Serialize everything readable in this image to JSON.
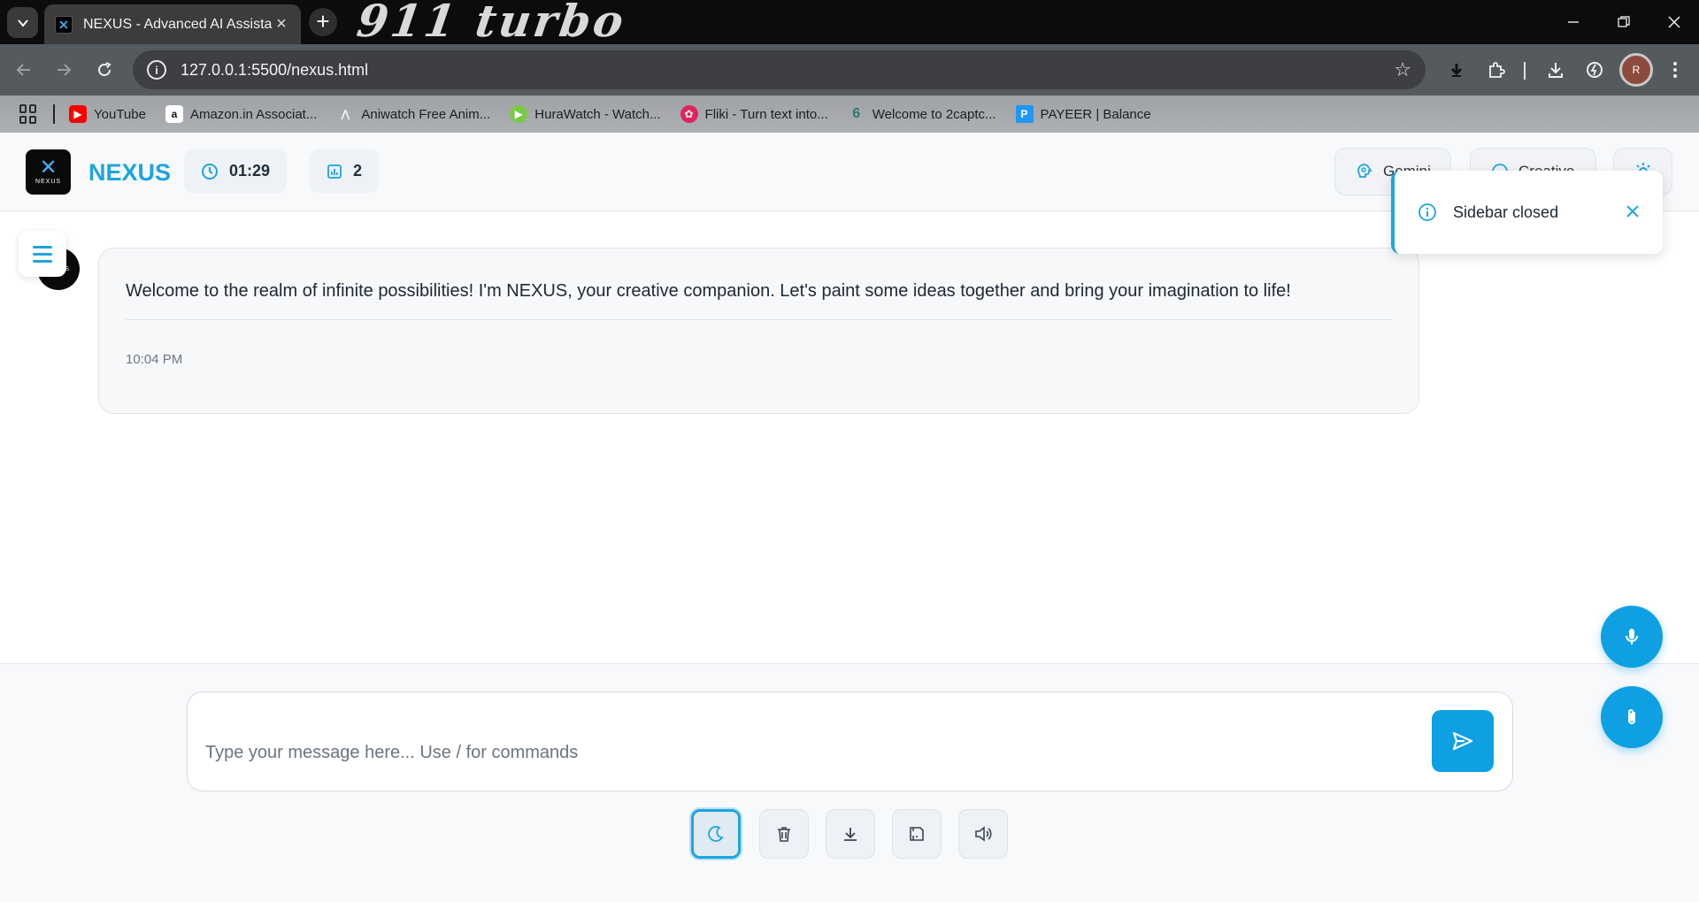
{
  "browser": {
    "tab_title": "NEXUS - Advanced AI Assistant",
    "theme_logo_text": "911 turbo",
    "url": "127.0.0.1:5500/nexus.html",
    "profile_initial": "R",
    "bookmarks": [
      {
        "label": "YouTube",
        "icon": "youtube-icon",
        "color": "#ff0000"
      },
      {
        "label": "Amazon.in Associat...",
        "icon": "amazon-icon",
        "color": "#ffffff"
      },
      {
        "label": "Aniwatch Free Anim...",
        "icon": "aniwatch-icon",
        "color": "#e8e8e8"
      },
      {
        "label": "HuraWatch - Watch...",
        "icon": "hurawatch-icon",
        "color": "#7ac943"
      },
      {
        "label": "Fliki - Turn text into...",
        "icon": "fliki-icon",
        "color": "#e0245e"
      },
      {
        "label": "Welcome to 2captc...",
        "icon": "2captcha-icon",
        "color": "#2b7a6f"
      },
      {
        "label": "PAYEER | Balance",
        "icon": "payeer-icon",
        "color": "#2196f3"
      }
    ]
  },
  "app": {
    "brand": "NEXUS",
    "logo_text": "NEXUS",
    "timer": "01:29",
    "message_count": "2",
    "model_button": "Gemini",
    "mode_button": "Creative",
    "accent_color": "#1ea5df"
  },
  "chat": {
    "avatar_text": "NEXUS",
    "messages": [
      {
        "text": "Welcome to the realm of infinite possibilities! I'm NEXUS, your creative companion. Let's paint some ideas together and bring your imagination to life!",
        "time": "10:04 PM"
      }
    ]
  },
  "toast": {
    "text": "Sidebar closed"
  },
  "input": {
    "placeholder": "Type your message here... Use / for commands",
    "value": ""
  },
  "actions": [
    "theme-toggle",
    "clear-chat",
    "export",
    "save",
    "voice-output"
  ]
}
